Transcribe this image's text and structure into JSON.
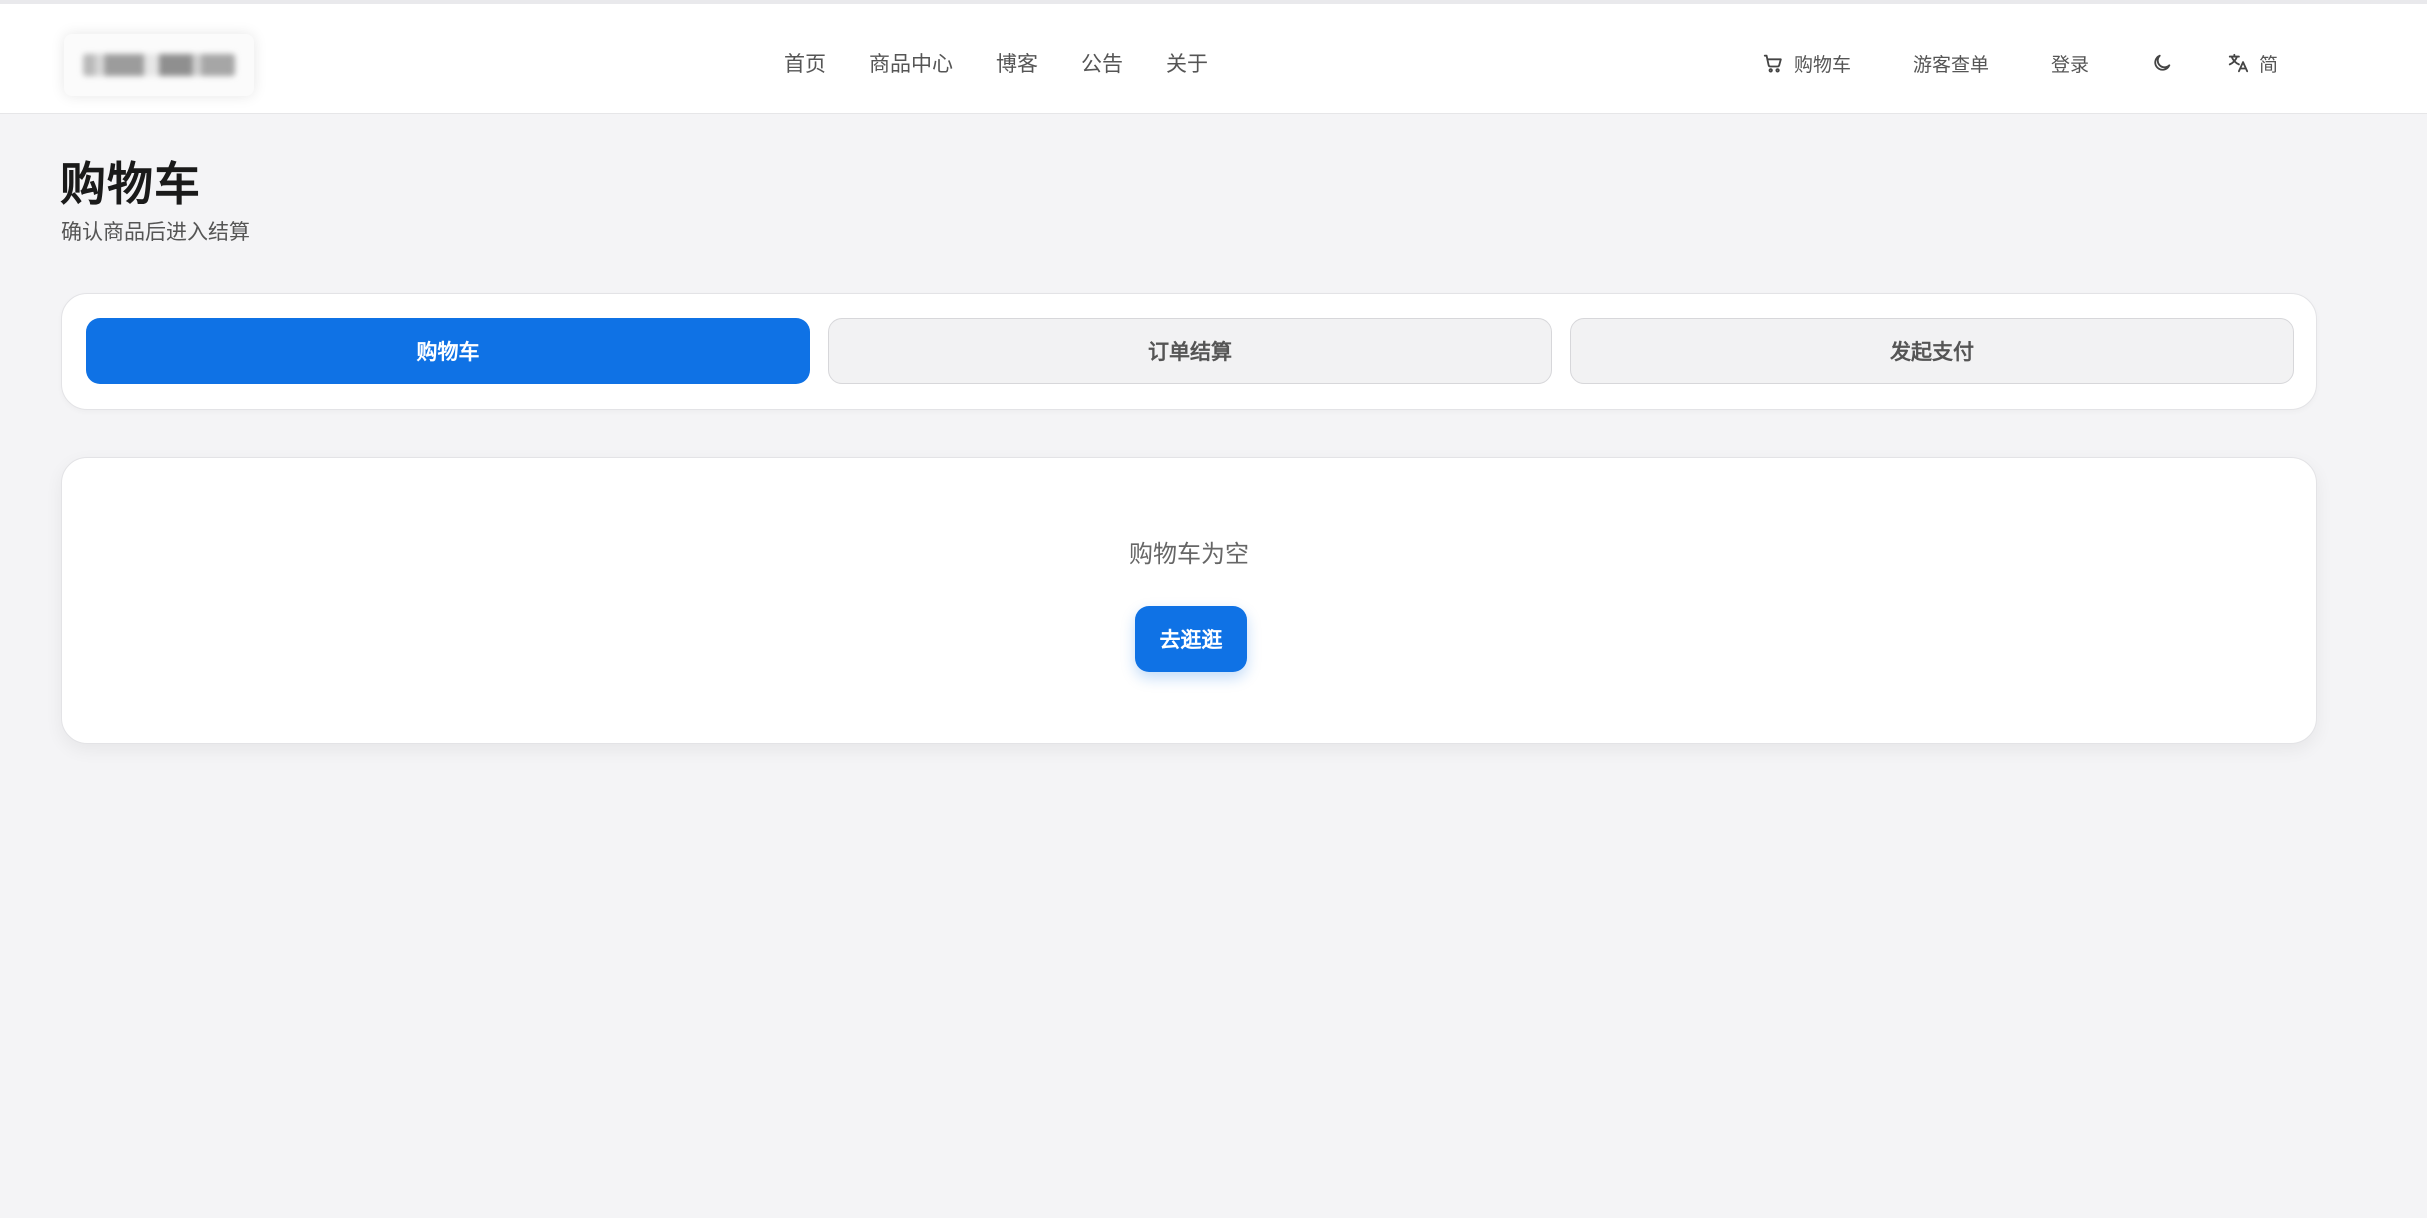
{
  "header": {
    "nav": [
      {
        "label": "首页"
      },
      {
        "label": "商品中心"
      },
      {
        "label": "博客"
      },
      {
        "label": "公告"
      },
      {
        "label": "关于"
      }
    ],
    "right": {
      "cart_label": "购物车",
      "guest_orders_label": "游客查单",
      "login_label": "登录",
      "language_label": "简",
      "icons": [
        "cart-icon",
        "moon-icon",
        "translate-icon"
      ]
    }
  },
  "page": {
    "title": "购物车",
    "subtitle": "确认商品后进入结算"
  },
  "steps": [
    {
      "label": "购物车",
      "active": true
    },
    {
      "label": "订单结算",
      "active": false
    },
    {
      "label": "发起支付",
      "active": false
    }
  ],
  "empty_state": {
    "message": "购物车为空",
    "button_label": "去逛逛"
  },
  "colors": {
    "accent": "#0f72e5",
    "background": "#f4f4f6"
  }
}
